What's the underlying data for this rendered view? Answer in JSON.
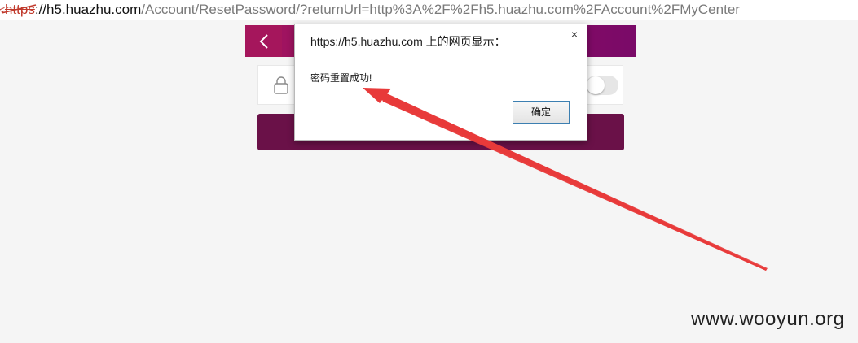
{
  "browser": {
    "url_scheme": "https",
    "url_host": "://h5.huazhu.com",
    "url_path": "/Account/ResetPassword/?returnUrl=http%3A%2F%2Fh5.huazhu.com%2FAccount%2FMyCenter",
    "security_icon": "broken-lock-icon",
    "security_color": "#c0392b"
  },
  "page": {
    "header_color": "#8b0a62",
    "back_icon": "chevron-left-icon",
    "password_icon": "lock-icon",
    "password_visible": false,
    "submit_color": "#6a1148"
  },
  "dialog": {
    "title": "https://h5.huazhu.com 上的网页显示：",
    "message": "密码重置成功!",
    "ok_label": "确定",
    "close_label": "×"
  },
  "annotation": {
    "arrow_color": "#e83a3a"
  },
  "watermark": {
    "text": "www.wooyun.org"
  }
}
